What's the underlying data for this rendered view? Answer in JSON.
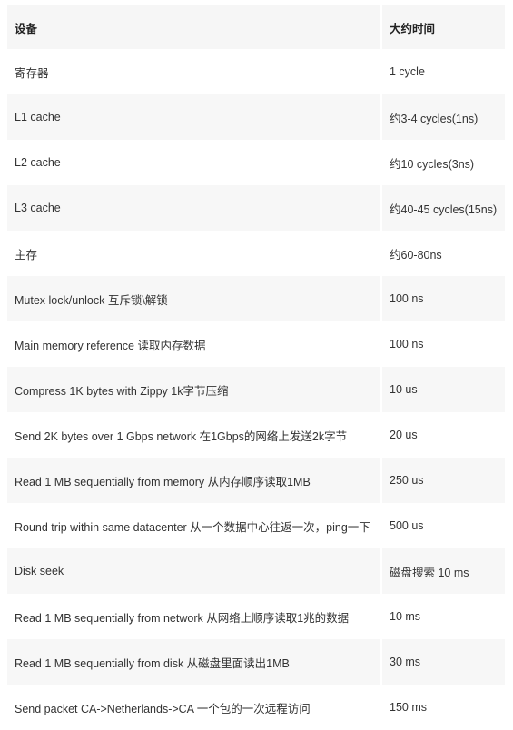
{
  "table": {
    "headers": [
      "设备",
      "大约时间"
    ],
    "rows": [
      {
        "device": "寄存器",
        "time": "1 cycle"
      },
      {
        "device": "L1 cache",
        "time": "约3-4 cycles(1ns)"
      },
      {
        "device": "L2 cache",
        "time": "约10 cycles(3ns)"
      },
      {
        "device": "L3 cache",
        "time": "约40-45 cycles(15ns)"
      },
      {
        "device": "主存",
        "time": "约60-80ns"
      },
      {
        "device": "Mutex lock/unlock 互斥锁\\解锁",
        "time": "100 ns"
      },
      {
        "device": "Main memory reference 读取内存数据",
        "time": "100 ns"
      },
      {
        "device": "Compress 1K bytes with Zippy 1k字节压缩",
        "time": "10 us"
      },
      {
        "device": "Send 2K bytes over 1 Gbps network 在1Gbps的网络上发送2k字节",
        "time": "20 us"
      },
      {
        "device": "Read 1 MB sequentially from memory 从内存顺序读取1MB",
        "time": "250 us"
      },
      {
        "device": "Round trip within same datacenter 从一个数据中心往返一次，ping一下",
        "time": "500 us"
      },
      {
        "device": "Disk seek",
        "time": "磁盘搜索 10 ms"
      },
      {
        "device": "Read 1 MB sequentially from network 从网络上顺序读取1兆的数据",
        "time": "10 ms"
      },
      {
        "device": "Read 1 MB sequentially from disk 从磁盘里面读出1MB",
        "time": "30 ms"
      },
      {
        "device": "Send packet CA->Netherlands->CA 一个包的一次远程访问",
        "time": "150 ms"
      }
    ]
  }
}
